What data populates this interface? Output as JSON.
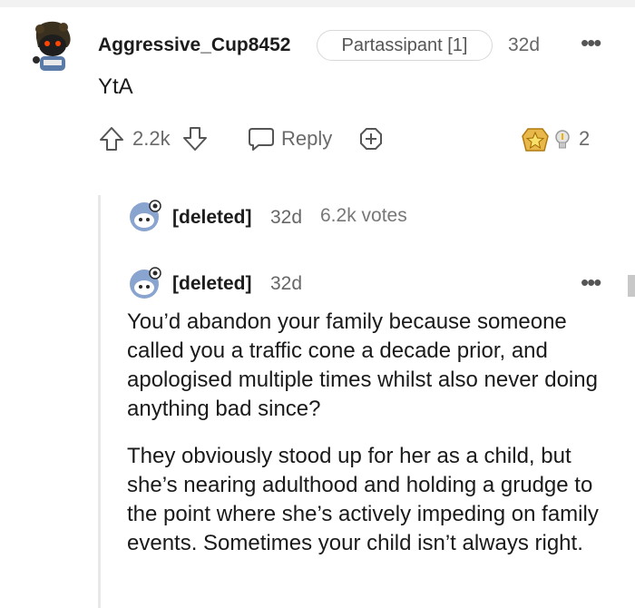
{
  "comment": {
    "username": "Aggressive_Cup8452",
    "flair": "Partassipant [1]",
    "age": "32d",
    "body": "YtA",
    "upvotes": "2.2k",
    "reply_label": "Reply",
    "award_count": "2"
  },
  "deleted_collapsed": {
    "username": "[deleted]",
    "age": "32d",
    "votes": "6.2k votes"
  },
  "deleted_reply": {
    "username": "[deleted]",
    "age": "32d",
    "paragraphs": [
      "You’d abandon your family because someone called you a traffic cone a decade prior, and apologised multiple times whilst also never doing anything bad since?",
      "They obviously stood up for her as a child, but she’s nearing adulthood and holding a grudge to the point where she’s actively impeding on family events. Sometimes your child isn’t always right."
    ]
  },
  "icons": [
    "avatar",
    "upvote-icon",
    "downvote-icon",
    "reply-icon",
    "add-award-icon",
    "award-star-icon",
    "award-bulb-icon",
    "more-options-icon"
  ]
}
